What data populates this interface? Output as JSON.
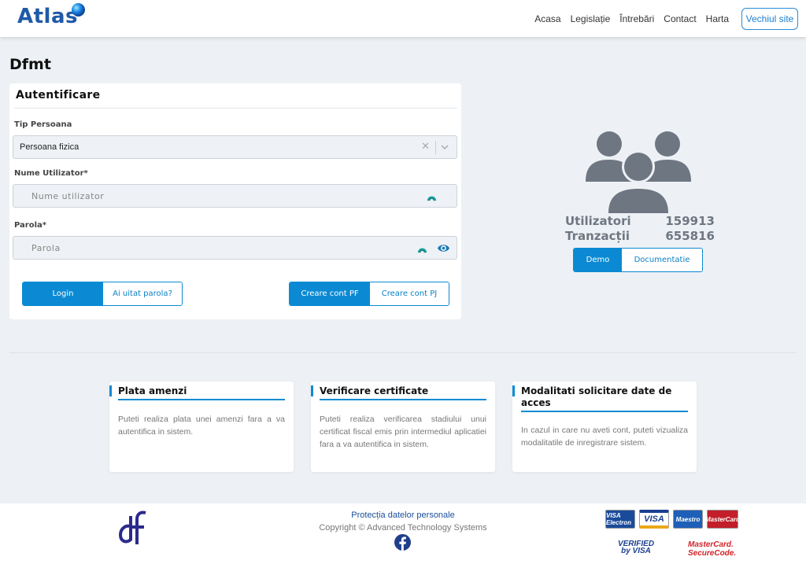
{
  "header": {
    "logo_text": "Atlas",
    "nav": [
      "Acasa",
      "Legislație",
      "Întrebări",
      "Contact",
      "Harta"
    ],
    "old_site_button": "Vechiul site"
  },
  "page_title": "Dfmt",
  "auth": {
    "title": "Autentificare",
    "tip_persoana_label": "Tip Persoana",
    "tip_persoana_value": "Persoana fizica",
    "username_label": "Nume Utilizator*",
    "username_placeholder": "Nume utilizator",
    "password_label": "Parola*",
    "password_placeholder": "Parola",
    "login_button": "Login",
    "forgot_button": "Ai uitat parola?",
    "create_pf_button": "Creare cont PF",
    "create_pj_button": "Creare cont PJ"
  },
  "stats": {
    "users_label": "Utilizatori",
    "users_value": "159913",
    "transactions_label": "Tranzacții",
    "transactions_value": "655816",
    "demo_button": "Demo",
    "docs_button": "Documentatie"
  },
  "info_cards": [
    {
      "title": "Plata amenzi",
      "body": "Puteti realiza plata unei amenzi fara a va autentifica in sistem."
    },
    {
      "title": "Verificare certificate",
      "body": "Puteti realiza verificarea stadiului unui certificat fiscal emis prin intermediul aplicatiei fara a va autentifica in sistem."
    },
    {
      "title": "Modalitati solicitare date de acces",
      "body": "In cazul in care nu aveti cont, puteti vizualiza modalitatile de inregistrare sistem."
    }
  ],
  "footer": {
    "privacy_link": "Protecția datelor personale",
    "copyright": "Copyright © Advanced Technology Systems",
    "payment_badges": [
      "VISA Electron",
      "VISA",
      "Maestro",
      "MasterCard"
    ],
    "verified_by_visa": "VERIFIED by VISA",
    "mastercard_securecode": "MasterCard. SecureCode."
  },
  "colors": {
    "primary": "#0b8ad3",
    "logo_blue": "#1f5aa6",
    "background": "#edf1f5",
    "stats_gray": "#6e7682"
  }
}
